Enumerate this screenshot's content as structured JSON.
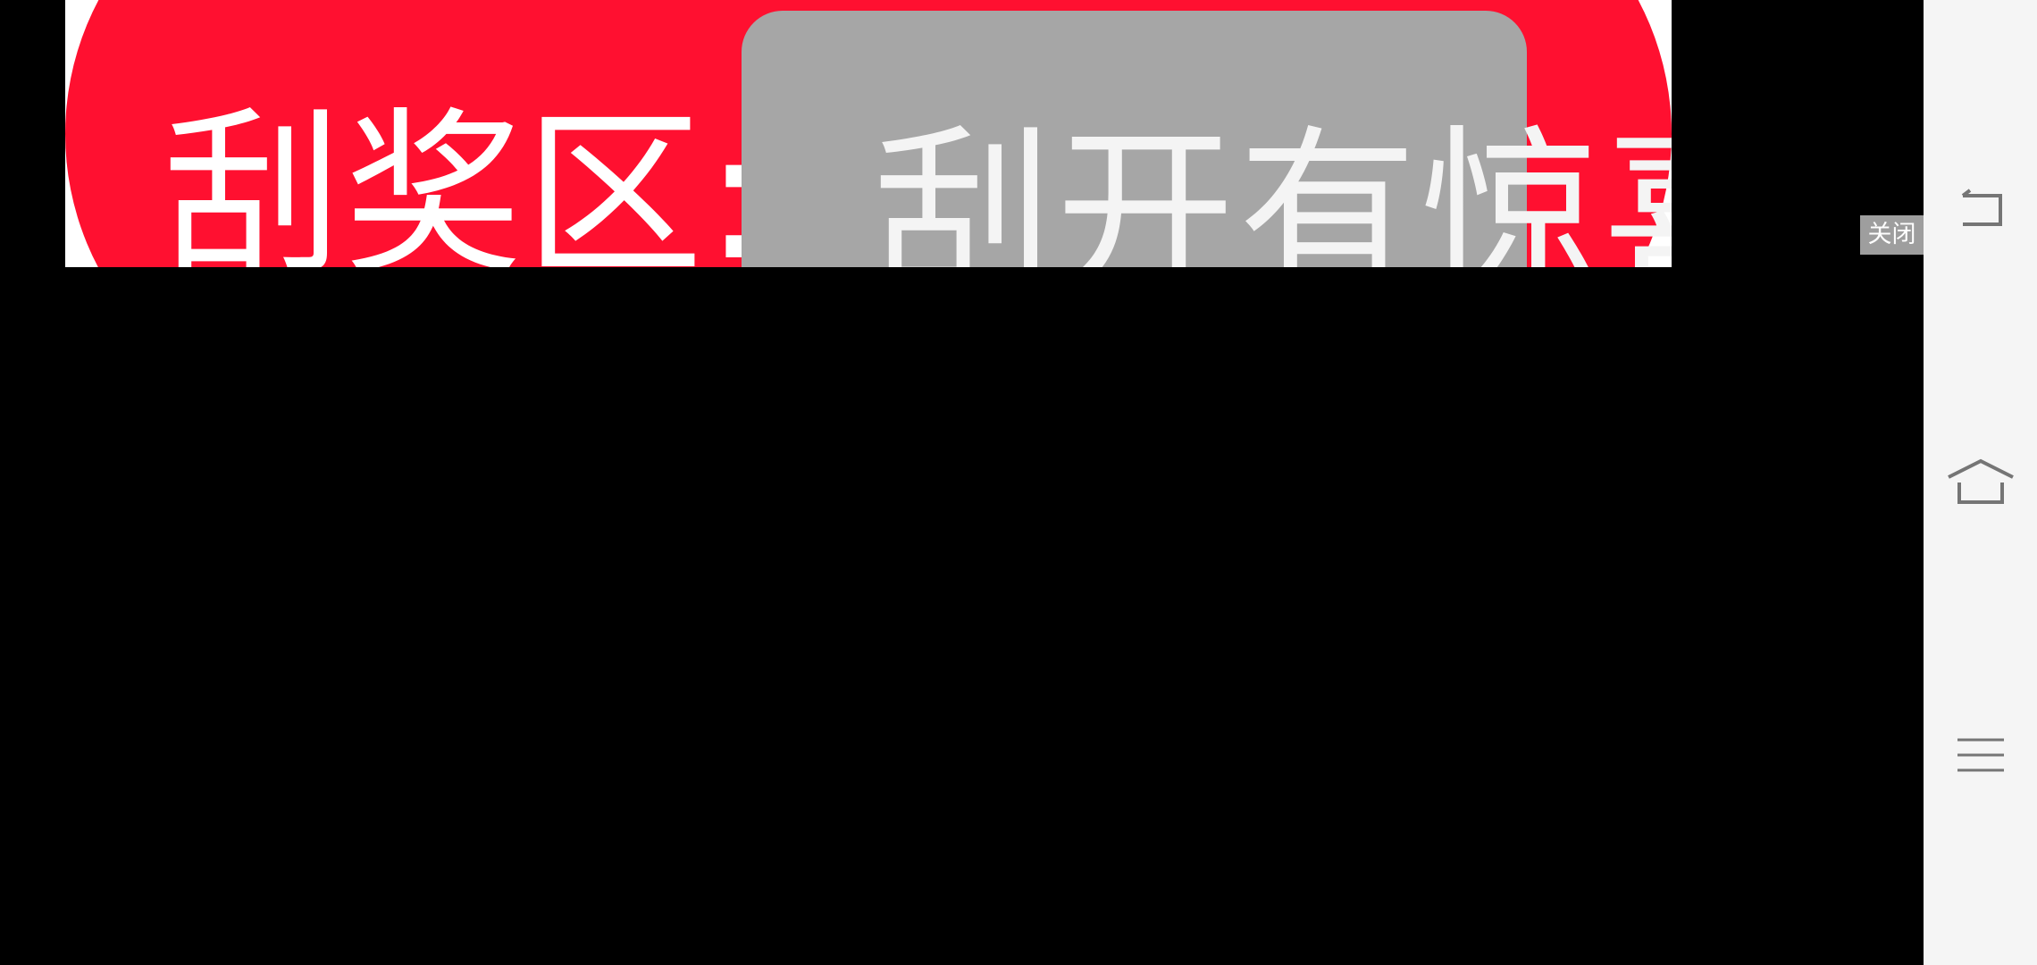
{
  "scratch_card": {
    "label": "刮奖区:",
    "hint": "刮开有惊喜",
    "card_color": "#ff1030",
    "surface_color": "#a6a6a6"
  },
  "overlay": {
    "close_label": "关闭"
  },
  "navigation_bar": {
    "buttons": [
      {
        "icon": "back-icon"
      },
      {
        "icon": "home-icon"
      },
      {
        "icon": "menu-icon"
      }
    ]
  }
}
